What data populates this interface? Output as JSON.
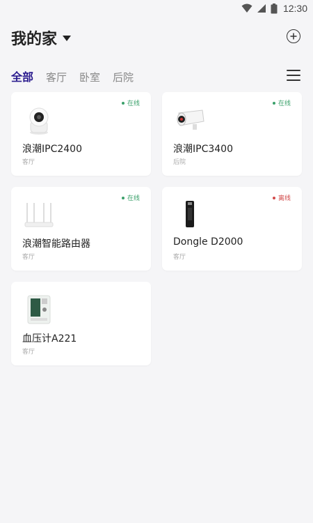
{
  "status_bar": {
    "time": "12:30"
  },
  "header": {
    "title": "我的家"
  },
  "tabs": [
    {
      "label": "全部",
      "active": true
    },
    {
      "label": "客厅",
      "active": false
    },
    {
      "label": "卧室",
      "active": false
    },
    {
      "label": "后院",
      "active": false
    }
  ],
  "devices": [
    {
      "name": "浪潮IPC2400",
      "room": "客厅",
      "status": "在线",
      "online": true,
      "icon": "dome-camera-icon"
    },
    {
      "name": "浪潮IPC3400",
      "room": "后院",
      "status": "在线",
      "online": true,
      "icon": "bullet-camera-icon"
    },
    {
      "name": "浪潮智能路由器",
      "room": "客厅",
      "status": "在线",
      "online": true,
      "icon": "router-icon"
    },
    {
      "name": "Dongle D2000",
      "room": "客厅",
      "status": "离线",
      "online": false,
      "icon": "dongle-icon"
    },
    {
      "name": "血压计A221",
      "room": "客厅",
      "status": "",
      "online": null,
      "icon": "blood-pressure-monitor-icon"
    }
  ],
  "colors": {
    "accent": "#2a1b8e",
    "online": "#3aa06a",
    "offline": "#d24a4a",
    "background": "#f5f5f7"
  }
}
